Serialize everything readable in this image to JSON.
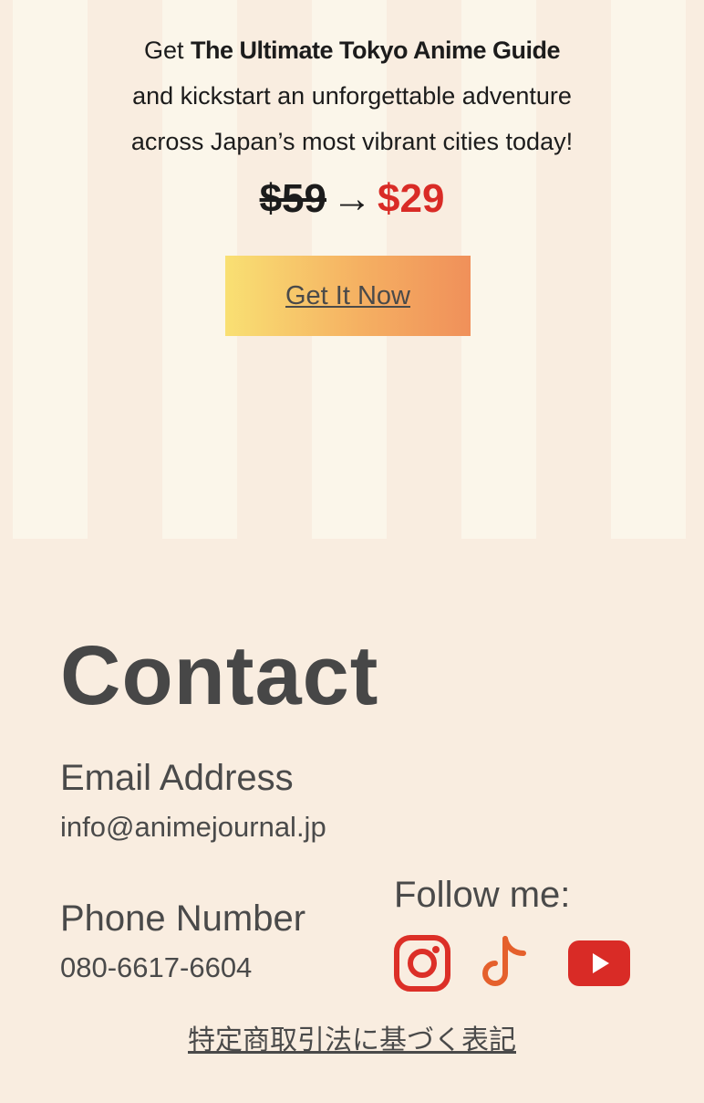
{
  "promo": {
    "line1_prefix": "Get",
    "line1_bold": "The Ultimate Tokyo Anime Guide",
    "line2": "and kickstart an unforgettable adventure",
    "line3": "across Japan’s most vibrant cities today!",
    "old_price": "$59",
    "arrow": "→",
    "new_price": "$29",
    "cta_label": "Get It Now"
  },
  "contact": {
    "title": "Contact",
    "email_label": "Email Address",
    "email_value": "info@animejournal.jp",
    "phone_label": "Phone Number",
    "phone_value": "080-6617-6604",
    "follow_label": "Follow me:",
    "social_icons": [
      "instagram-icon",
      "tiktok-icon",
      "youtube-icon"
    ],
    "legal_link": "特定商取引法に基づく表記"
  },
  "colors": {
    "background": "#f9ede0",
    "stripe": "#fbf6ea",
    "sale_price": "#d92b26",
    "instagram": "#dc2f27",
    "tiktok": "#e5602c",
    "youtube": "#d92b26"
  }
}
